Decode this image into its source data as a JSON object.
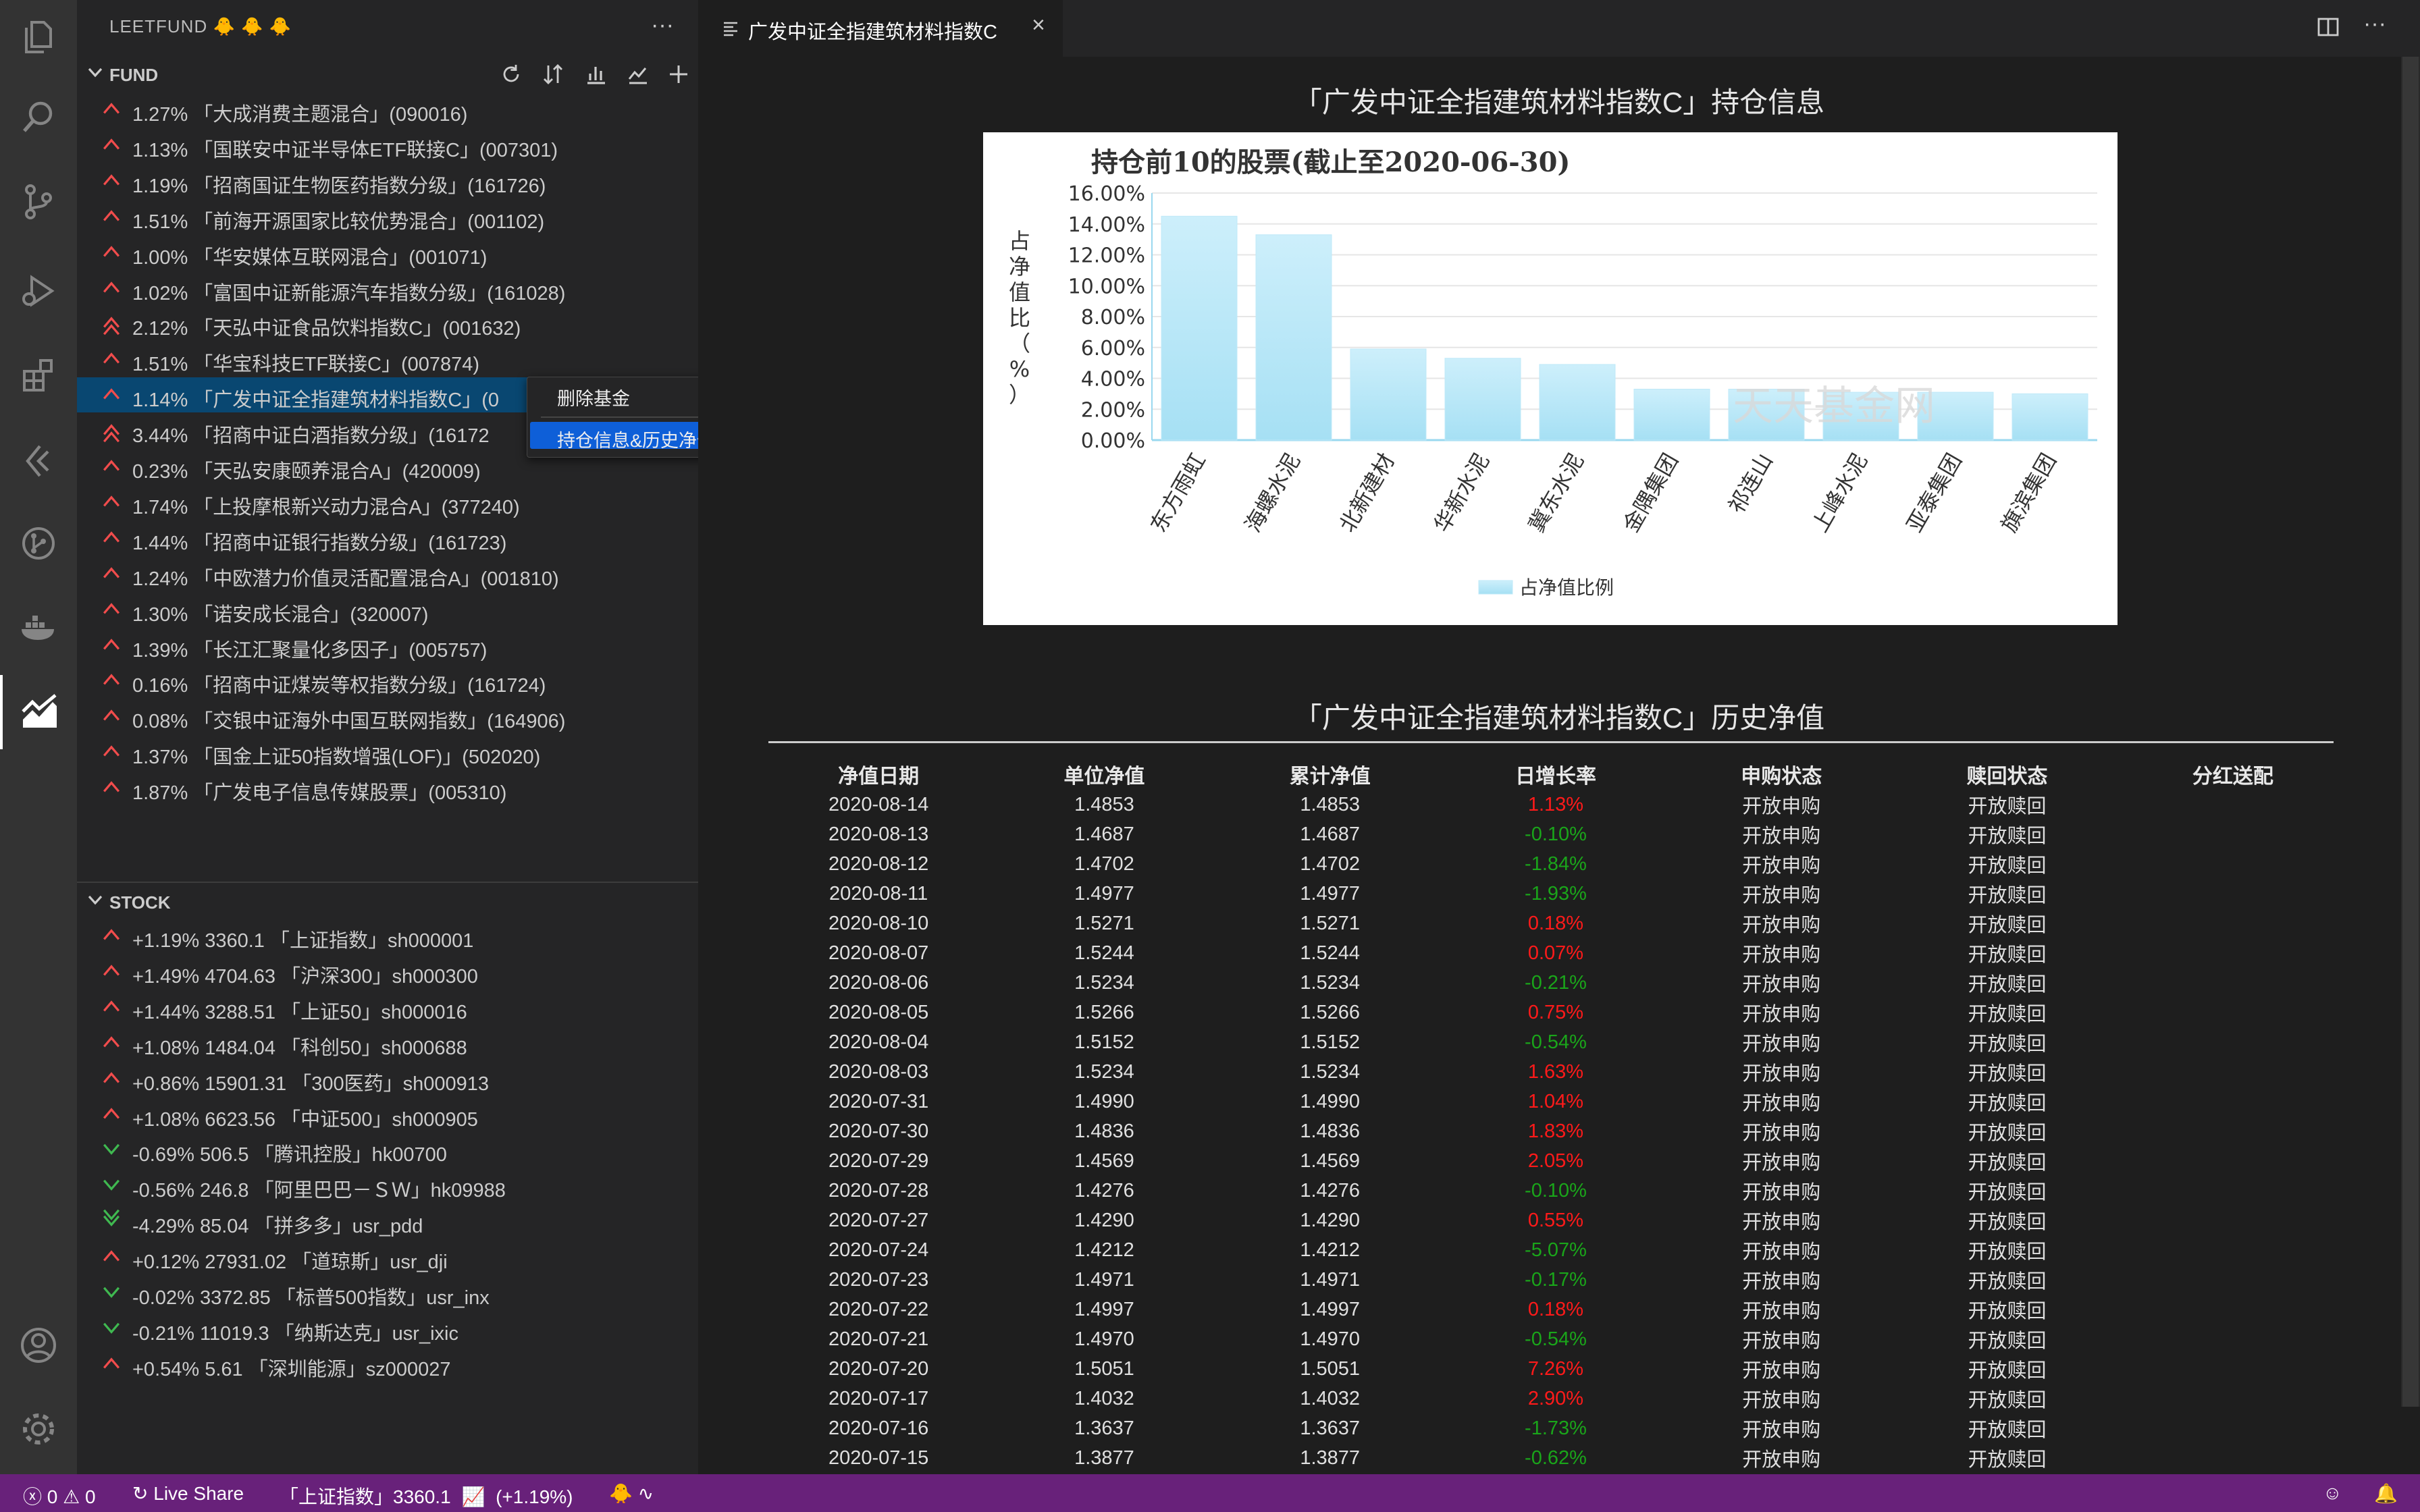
{
  "sidebar": {
    "title": "LEETFUND 🐥 🐥 🐥",
    "fund_section": {
      "label": "FUND",
      "items": [
        {
          "text": "1.27%   「大成消费主题混合」(090016)",
          "dir": "up"
        },
        {
          "text": "1.13%   「国联安中证半导体ETF联接C」(007301)",
          "dir": "up"
        },
        {
          "text": "1.19%   「招商国证生物医药指数分级」(161726)",
          "dir": "up"
        },
        {
          "text": "1.51%   「前海开源国家比较优势混合」(001102)",
          "dir": "up"
        },
        {
          "text": "1.00%   「华安媒体互联网混合」(001071)",
          "dir": "up"
        },
        {
          "text": "1.02%   「富国中证新能源汽车指数分级」(161028)",
          "dir": "up"
        },
        {
          "text": "2.12%   「天弘中证食品饮料指数C」(001632)",
          "dir": "up2"
        },
        {
          "text": "1.51%   「华宝科技ETF联接C」(007874)",
          "dir": "up"
        },
        {
          "text": "1.14%   「广发中证全指建筑材料指数C」(0",
          "dir": "up"
        },
        {
          "text": "3.44%   「招商中证白酒指数分级」(16172",
          "dir": "up2"
        },
        {
          "text": "0.23%   「天弘安康颐养混合A」(420009)",
          "dir": "up"
        },
        {
          "text": "1.74%   「上投摩根新兴动力混合A」(377240)",
          "dir": "up"
        },
        {
          "text": "1.44%   「招商中证银行指数分级」(161723)",
          "dir": "up"
        },
        {
          "text": "1.24%   「中欧潜力价值灵活配置混合A」(001810)",
          "dir": "up"
        },
        {
          "text": "1.30%   「诺安成长混合」(320007)",
          "dir": "up"
        },
        {
          "text": "1.39%   「长江汇聚量化多因子」(005757)",
          "dir": "up"
        },
        {
          "text": "0.16%   「招商中证煤炭等权指数分级」(161724)",
          "dir": "up"
        },
        {
          "text": "0.08%   「交银中证海外中国互联网指数」(164906)",
          "dir": "up"
        },
        {
          "text": "1.37%   「国金上证50指数增强(LOF)」(502020)",
          "dir": "up"
        },
        {
          "text": "1.87%   「广发电子信息传媒股票」(005310)",
          "dir": "up"
        }
      ]
    },
    "stock_section": {
      "label": "STOCK",
      "items": [
        {
          "text": "+1.19%   3360.1    「上证指数」sh000001",
          "dir": "up"
        },
        {
          "text": "+1.49%   4704.63    「沪深300」sh000300",
          "dir": "up"
        },
        {
          "text": "+1.44%   3288.51    「上证50」sh000016",
          "dir": "up"
        },
        {
          "text": "+1.08%   1484.04    「科创50」sh000688",
          "dir": "up"
        },
        {
          "text": "+0.86%   15901.31    「300医药」sh000913",
          "dir": "up"
        },
        {
          "text": "+1.08%   6623.56    「中证500」sh000905",
          "dir": "up"
        },
        {
          "text": "-0.69%   506.5    「腾讯控股」hk00700",
          "dir": "down"
        },
        {
          "text": "-0.56%   246.8    「阿里巴巴－ＳＷ」hk09988",
          "dir": "down"
        },
        {
          "text": "-4.29%   85.04    「拼多多」usr_pdd",
          "dir": "down2"
        },
        {
          "text": "+0.12%   27931.02    「道琼斯」usr_dji",
          "dir": "up"
        },
        {
          "text": "-0.02%   3372.85    「标普500指数」usr_inx",
          "dir": "down"
        },
        {
          "text": "-0.21%   11019.3    「纳斯达克」usr_ixic",
          "dir": "down"
        },
        {
          "text": "+0.54%   5.61    「深圳能源」sz000027",
          "dir": "up"
        }
      ]
    }
  },
  "context_menu": {
    "item1": "删除基金",
    "item2": "持仓信息&历史净值列表"
  },
  "tab": {
    "label": "广发中证全指建筑材料指数C"
  },
  "page": {
    "holdings_title": "「广发中证全指建筑材料指数C」持仓信息",
    "history_title": "「广发中证全指建筑材料指数C」历史净值"
  },
  "chart_data": {
    "type": "bar",
    "title": "持仓前10的股票(截止至2020-06-30)",
    "ylabel": "占净值比（%）",
    "categories": [
      "东方雨虹",
      "海螺水泥",
      "北新建材",
      "华新水泥",
      "冀东水泥",
      "金隅集团",
      "祁连山",
      "上峰水泥",
      "亚泰集团",
      "旗滨集团"
    ],
    "values": [
      14.5,
      13.3,
      5.9,
      5.3,
      4.9,
      3.3,
      3.3,
      3.1,
      3.1,
      3.0
    ],
    "ylim": [
      0,
      16
    ],
    "yticks": [
      "0.00%",
      "2.00%",
      "4.00%",
      "6.00%",
      "8.00%",
      "10.00%",
      "12.00%",
      "14.00%",
      "16.00%"
    ],
    "legend": "占净值比例",
    "watermark": "天天基金网",
    "colors": {
      "bar_top": "#cdeffb",
      "bar_bottom": "#a6e0f4"
    }
  },
  "history": {
    "headers": [
      "净值日期",
      "单位净值",
      "累计净值",
      "日增长率",
      "申购状态",
      "赎回状态",
      "分红送配"
    ],
    "rows": [
      [
        "2020-08-14",
        "1.4853",
        "1.4853",
        "1.13%",
        "开放申购",
        "开放赎回",
        ""
      ],
      [
        "2020-08-13",
        "1.4687",
        "1.4687",
        "-0.10%",
        "开放申购",
        "开放赎回",
        ""
      ],
      [
        "2020-08-12",
        "1.4702",
        "1.4702",
        "-1.84%",
        "开放申购",
        "开放赎回",
        ""
      ],
      [
        "2020-08-11",
        "1.4977",
        "1.4977",
        "-1.93%",
        "开放申购",
        "开放赎回",
        ""
      ],
      [
        "2020-08-10",
        "1.5271",
        "1.5271",
        "0.18%",
        "开放申购",
        "开放赎回",
        ""
      ],
      [
        "2020-08-07",
        "1.5244",
        "1.5244",
        "0.07%",
        "开放申购",
        "开放赎回",
        ""
      ],
      [
        "2020-08-06",
        "1.5234",
        "1.5234",
        "-0.21%",
        "开放申购",
        "开放赎回",
        ""
      ],
      [
        "2020-08-05",
        "1.5266",
        "1.5266",
        "0.75%",
        "开放申购",
        "开放赎回",
        ""
      ],
      [
        "2020-08-04",
        "1.5152",
        "1.5152",
        "-0.54%",
        "开放申购",
        "开放赎回",
        ""
      ],
      [
        "2020-08-03",
        "1.5234",
        "1.5234",
        "1.63%",
        "开放申购",
        "开放赎回",
        ""
      ],
      [
        "2020-07-31",
        "1.4990",
        "1.4990",
        "1.04%",
        "开放申购",
        "开放赎回",
        ""
      ],
      [
        "2020-07-30",
        "1.4836",
        "1.4836",
        "1.83%",
        "开放申购",
        "开放赎回",
        ""
      ],
      [
        "2020-07-29",
        "1.4569",
        "1.4569",
        "2.05%",
        "开放申购",
        "开放赎回",
        ""
      ],
      [
        "2020-07-28",
        "1.4276",
        "1.4276",
        "-0.10%",
        "开放申购",
        "开放赎回",
        ""
      ],
      [
        "2020-07-27",
        "1.4290",
        "1.4290",
        "0.55%",
        "开放申购",
        "开放赎回",
        ""
      ],
      [
        "2020-07-24",
        "1.4212",
        "1.4212",
        "-5.07%",
        "开放申购",
        "开放赎回",
        ""
      ],
      [
        "2020-07-23",
        "1.4971",
        "1.4971",
        "-0.17%",
        "开放申购",
        "开放赎回",
        ""
      ],
      [
        "2020-07-22",
        "1.4997",
        "1.4997",
        "0.18%",
        "开放申购",
        "开放赎回",
        ""
      ],
      [
        "2020-07-21",
        "1.4970",
        "1.4970",
        "-0.54%",
        "开放申购",
        "开放赎回",
        ""
      ],
      [
        "2020-07-20",
        "1.5051",
        "1.5051",
        "7.26%",
        "开放申购",
        "开放赎回",
        ""
      ],
      [
        "2020-07-17",
        "1.4032",
        "1.4032",
        "2.90%",
        "开放申购",
        "开放赎回",
        ""
      ],
      [
        "2020-07-16",
        "1.3637",
        "1.3637",
        "-1.73%",
        "开放申购",
        "开放赎回",
        ""
      ],
      [
        "2020-07-15",
        "1.3877",
        "1.3877",
        "-0.62%",
        "开放申购",
        "开放赎回",
        ""
      ]
    ]
  },
  "status": {
    "problems": "0",
    "warnings": "0",
    "live_share": "Live Share",
    "index": "「上证指数」3360.1",
    "index_change": "(+1.19%)"
  },
  "colors": {
    "status_bar": "#68217a",
    "up": "#f14c4c",
    "down": "#3fb950",
    "selection": "#094771",
    "menu_highlight": "#0e5fd8"
  }
}
